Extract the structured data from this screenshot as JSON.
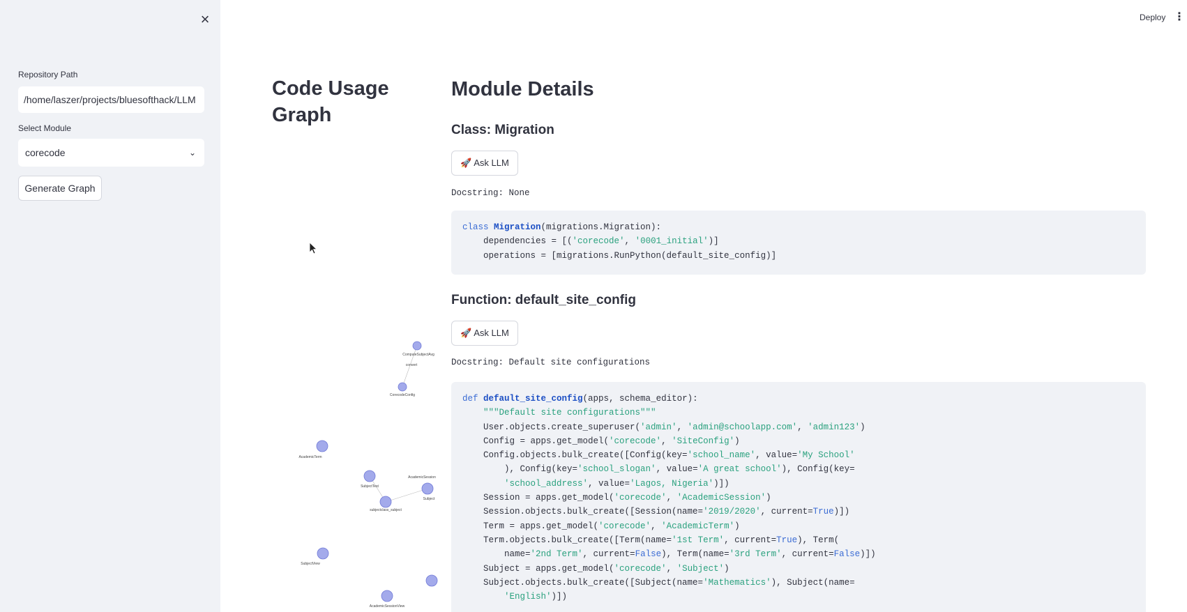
{
  "sidebar": {
    "repo_label": "Repository Path",
    "repo_value": "/home/laszer/projects/bluesofthack/LLM",
    "module_label": "Select Module",
    "module_value": "corecode",
    "generate_button": "Generate Graph"
  },
  "header": {
    "deploy_label": "Deploy"
  },
  "graph": {
    "title": "Code Usage Graph",
    "nodes": [
      "ComputeSubjectAvg",
      "convert",
      "CorecodeConfig",
      "AcademicTerm",
      "SubjectTest",
      "AcademicSession",
      "Subject",
      "subjectclass_subject",
      "SubjectView",
      "AcademicSessionView"
    ]
  },
  "details": {
    "heading": "Module Details",
    "sections": [
      {
        "title": "Class: Migration",
        "ask_label": "Ask LLM",
        "docstring": "Docstring: None",
        "code": [
          "class Migration(migrations.Migration):",
          "    dependencies = [('corecode', '0001_initial')]",
          "    operations = [migrations.RunPython(default_site_config)]"
        ]
      },
      {
        "title": "Function: default_site_config",
        "ask_label": "Ask LLM",
        "docstring": "Docstring: Default site configurations",
        "code": [
          "def default_site_config(apps, schema_editor):",
          "    \"\"\"Default site configurations\"\"\"",
          "    User.objects.create_superuser('admin', 'admin@schoolapp.com', 'admin123')",
          "    Config = apps.get_model('corecode', 'SiteConfig')",
          "    Config.objects.bulk_create([Config(key='school_name', value='My School'",
          "        ), Config(key='school_slogan', value='A great school'), Config(key=",
          "        'school_address', value='Lagos, Nigeria')])",
          "    Session = apps.get_model('corecode', 'AcademicSession')",
          "    Session.objects.bulk_create([Session(name='2019/2020', current=True)])",
          "    Term = apps.get_model('corecode', 'AcademicTerm')",
          "    Term.objects.bulk_create([Term(name='1st Term', current=True), Term(",
          "        name='2nd Term', current=False), Term(name='3rd Term', current=False)])",
          "    Subject = apps.get_model('corecode', 'Subject')",
          "    Subject.objects.bulk_create([Subject(name='Mathematics'), Subject(name=",
          "        'English')])"
        ]
      }
    ]
  }
}
